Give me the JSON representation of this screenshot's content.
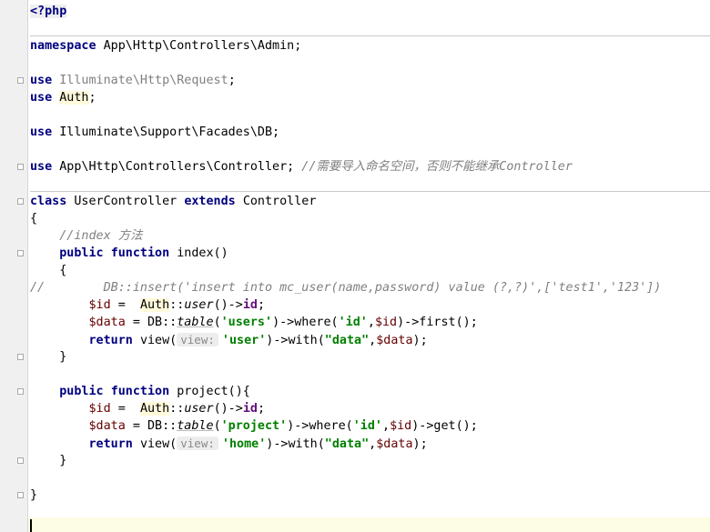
{
  "editor": {
    "language": "php",
    "lines": [
      {
        "tokens": [
          {
            "t": "<?php",
            "c": "tag"
          }
        ]
      },
      {
        "tokens": []
      },
      {
        "tokens": [
          {
            "t": "namespace ",
            "c": "kw"
          },
          {
            "t": "App\\Http\\Controllers\\Admin;",
            "c": ""
          }
        ]
      },
      {
        "tokens": []
      },
      {
        "tokens": [
          {
            "t": "use ",
            "c": "kw"
          },
          {
            "t": "Illuminate\\Http\\Request",
            "c": "unres"
          },
          {
            "t": ";",
            "c": ""
          }
        ]
      },
      {
        "tokens": [
          {
            "t": "use ",
            "c": "kw"
          },
          {
            "t": "Auth",
            "c": "auth"
          },
          {
            "t": ";",
            "c": ""
          }
        ]
      },
      {
        "tokens": []
      },
      {
        "tokens": [
          {
            "t": "use ",
            "c": "kw"
          },
          {
            "t": "Illuminate\\Support\\Facades\\DB;",
            "c": ""
          }
        ]
      },
      {
        "tokens": []
      },
      {
        "tokens": [
          {
            "t": "use ",
            "c": "kw"
          },
          {
            "t": "App\\Http\\Controllers\\Controller; ",
            "c": ""
          },
          {
            "t": "//需要导入命名空间，否则不能继承Controller",
            "c": "cm"
          }
        ]
      },
      {
        "tokens": []
      },
      {
        "tokens": [
          {
            "t": "class ",
            "c": "kw"
          },
          {
            "t": "UserController ",
            "c": ""
          },
          {
            "t": "extends ",
            "c": "kw"
          },
          {
            "t": "Controller",
            "c": ""
          }
        ]
      },
      {
        "tokens": [
          {
            "t": "{",
            "c": ""
          }
        ]
      },
      {
        "tokens": [
          {
            "t": "    ",
            "c": ""
          },
          {
            "t": "//index 方法",
            "c": "cm"
          }
        ]
      },
      {
        "tokens": [
          {
            "t": "    ",
            "c": ""
          },
          {
            "t": "public ",
            "c": "kw"
          },
          {
            "t": "function ",
            "c": "kw"
          },
          {
            "t": "index()",
            "c": ""
          }
        ]
      },
      {
        "tokens": [
          {
            "t": "    {",
            "c": ""
          }
        ]
      },
      {
        "tokens": [
          {
            "t": "//        DB::insert('insert into mc_user(name,password) value (?,?)',['test1','123'])",
            "c": "cm"
          }
        ]
      },
      {
        "tokens": [
          {
            "t": "        ",
            "c": ""
          },
          {
            "t": "$id",
            "c": "var"
          },
          {
            "t": " =  ",
            "c": ""
          },
          {
            "t": "Auth",
            "c": "auth"
          },
          {
            "t": "::",
            "c": ""
          },
          {
            "t": "user",
            "c": "fn"
          },
          {
            "t": "()->",
            "c": ""
          },
          {
            "t": "id",
            "c": "field"
          },
          {
            "t": ";",
            "c": ""
          }
        ]
      },
      {
        "tokens": [
          {
            "t": "        ",
            "c": ""
          },
          {
            "t": "$data",
            "c": "var"
          },
          {
            "t": " = DB::",
            "c": ""
          },
          {
            "t": "table",
            "c": "tbl"
          },
          {
            "t": "(",
            "c": ""
          },
          {
            "t": "'users'",
            "c": "str"
          },
          {
            "t": ")->where(",
            "c": ""
          },
          {
            "t": "'id'",
            "c": "str"
          },
          {
            "t": ",",
            "c": ""
          },
          {
            "t": "$id",
            "c": "var"
          },
          {
            "t": ")->first();",
            "c": ""
          }
        ]
      },
      {
        "tokens": [
          {
            "t": "        ",
            "c": ""
          },
          {
            "t": "return ",
            "c": "kw"
          },
          {
            "t": "view(",
            "c": ""
          },
          {
            "t": "view:",
            "c": "hint"
          },
          {
            "t": "'user'",
            "c": "str"
          },
          {
            "t": ")->with(",
            "c": ""
          },
          {
            "t": "\"data\"",
            "c": "str"
          },
          {
            "t": ",",
            "c": ""
          },
          {
            "t": "$data",
            "c": "var"
          },
          {
            "t": ");",
            "c": ""
          }
        ]
      },
      {
        "tokens": [
          {
            "t": "    }",
            "c": ""
          }
        ]
      },
      {
        "tokens": []
      },
      {
        "tokens": [
          {
            "t": "    ",
            "c": ""
          },
          {
            "t": "public ",
            "c": "kw"
          },
          {
            "t": "function ",
            "c": "kw"
          },
          {
            "t": "project(){",
            "c": ""
          }
        ]
      },
      {
        "tokens": [
          {
            "t": "        ",
            "c": ""
          },
          {
            "t": "$id",
            "c": "var"
          },
          {
            "t": " =  ",
            "c": ""
          },
          {
            "t": "Auth",
            "c": "auth"
          },
          {
            "t": "::",
            "c": ""
          },
          {
            "t": "user",
            "c": "fn"
          },
          {
            "t": "()->",
            "c": ""
          },
          {
            "t": "id",
            "c": "field"
          },
          {
            "t": ";",
            "c": ""
          }
        ]
      },
      {
        "tokens": [
          {
            "t": "        ",
            "c": ""
          },
          {
            "t": "$data",
            "c": "var"
          },
          {
            "t": " = DB::",
            "c": ""
          },
          {
            "t": "table",
            "c": "tbl"
          },
          {
            "t": "(",
            "c": ""
          },
          {
            "t": "'project'",
            "c": "str"
          },
          {
            "t": ")->where(",
            "c": ""
          },
          {
            "t": "'id'",
            "c": "str"
          },
          {
            "t": ",",
            "c": ""
          },
          {
            "t": "$id",
            "c": "var"
          },
          {
            "t": ")->get();",
            "c": ""
          }
        ]
      },
      {
        "tokens": [
          {
            "t": "        ",
            "c": ""
          },
          {
            "t": "return ",
            "c": "kw"
          },
          {
            "t": "view(",
            "c": ""
          },
          {
            "t": "view:",
            "c": "hint"
          },
          {
            "t": "'home'",
            "c": "str"
          },
          {
            "t": ")->with(",
            "c": ""
          },
          {
            "t": "\"data\"",
            "c": "str"
          },
          {
            "t": ",",
            "c": ""
          },
          {
            "t": "$data",
            "c": "var"
          },
          {
            "t": ");",
            "c": ""
          }
        ]
      },
      {
        "tokens": [
          {
            "t": "    }",
            "c": ""
          }
        ]
      },
      {
        "tokens": []
      },
      {
        "tokens": [
          {
            "t": "}",
            "c": ""
          }
        ]
      }
    ]
  }
}
